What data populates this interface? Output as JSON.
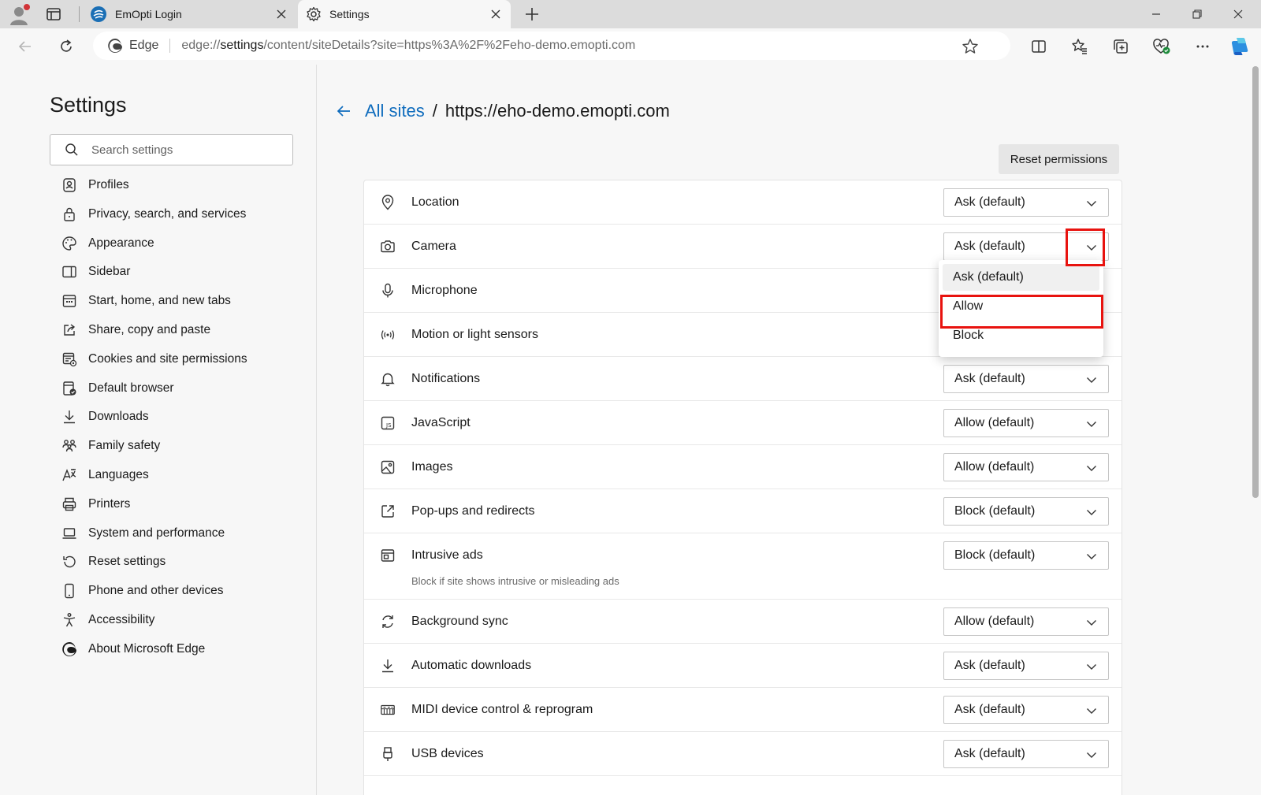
{
  "tabs": [
    {
      "title": "EmOpti Login",
      "icon": "emopti-icon",
      "active": false
    },
    {
      "title": "Settings",
      "icon": "gear-icon",
      "active": true
    }
  ],
  "toolbar": {
    "edge_label": "Edge",
    "url_prefix": "edge://",
    "url_host": "settings",
    "url_rest": "/content/siteDetails?site=https%3A%2F%2Feho-demo.emopti.com"
  },
  "sidebar": {
    "title": "Settings",
    "search_placeholder": "Search settings",
    "items": [
      {
        "label": "Profiles",
        "icon": "profiles-icon"
      },
      {
        "label": "Privacy, search, and services",
        "icon": "lock-icon"
      },
      {
        "label": "Appearance",
        "icon": "palette-icon"
      },
      {
        "label": "Sidebar",
        "icon": "sidebar-icon"
      },
      {
        "label": "Start, home, and new tabs",
        "icon": "home-tabs-icon"
      },
      {
        "label": "Share, copy and paste",
        "icon": "share-icon"
      },
      {
        "label": "Cookies and site permissions",
        "icon": "cookies-icon"
      },
      {
        "label": "Default browser",
        "icon": "default-browser-icon"
      },
      {
        "label": "Downloads",
        "icon": "download-icon"
      },
      {
        "label": "Family safety",
        "icon": "family-icon"
      },
      {
        "label": "Languages",
        "icon": "languages-icon"
      },
      {
        "label": "Printers",
        "icon": "printer-icon"
      },
      {
        "label": "System and performance",
        "icon": "laptop-icon"
      },
      {
        "label": "Reset settings",
        "icon": "reset-icon"
      },
      {
        "label": "Phone and other devices",
        "icon": "phone-icon"
      },
      {
        "label": "Accessibility",
        "icon": "accessibility-icon"
      },
      {
        "label": "About Microsoft Edge",
        "icon": "edge-logo-icon"
      }
    ]
  },
  "main": {
    "breadcrumb_link": "All sites",
    "breadcrumb_sep": "/",
    "site": "https://eho-demo.emopti.com",
    "reset_label": "Reset permissions",
    "permissions": [
      {
        "label": "Location",
        "value": "Ask (default)",
        "icon": "location-icon"
      },
      {
        "label": "Camera",
        "value": "Ask (default)",
        "icon": "camera-icon"
      },
      {
        "label": "Microphone",
        "value": "",
        "icon": "microphone-icon"
      },
      {
        "label": "Motion or light sensors",
        "value": "",
        "icon": "sensors-icon"
      },
      {
        "label": "Notifications",
        "value": "Ask (default)",
        "icon": "bell-icon"
      },
      {
        "label": "JavaScript",
        "value": "Allow (default)",
        "icon": "javascript-icon"
      },
      {
        "label": "Images",
        "value": "Allow (default)",
        "icon": "image-icon"
      },
      {
        "label": "Pop-ups and redirects",
        "value": "Block (default)",
        "icon": "popup-icon"
      },
      {
        "label": "Intrusive ads",
        "value": "Block (default)",
        "icon": "ads-icon",
        "sub": "Block if site shows intrusive or misleading ads"
      },
      {
        "label": "Background sync",
        "value": "Allow (default)",
        "icon": "sync-icon"
      },
      {
        "label": "Automatic downloads",
        "value": "Ask (default)",
        "icon": "download-icon"
      },
      {
        "label": "MIDI device control & reprogram",
        "value": "Ask (default)",
        "icon": "midi-icon"
      },
      {
        "label": "USB devices",
        "value": "Ask (default)",
        "icon": "usb-icon"
      }
    ],
    "dropdown": {
      "options": [
        "Ask (default)",
        "Allow",
        "Block"
      ],
      "selected": "Ask (default)",
      "highlighted": "Allow"
    }
  },
  "colors": {
    "accent": "#0f6cbd",
    "highlight": "#e8130f"
  }
}
